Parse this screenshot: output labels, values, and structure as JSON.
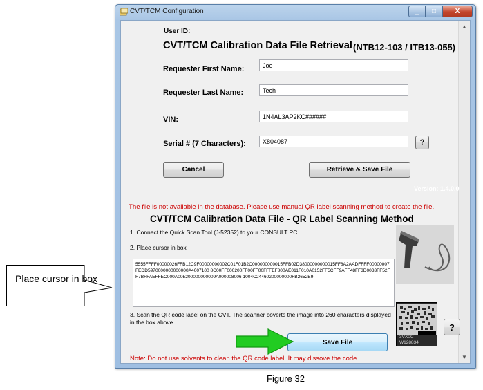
{
  "window": {
    "title": "CVT/TCM Configuration",
    "minimize": "_",
    "maximize": "□",
    "close": "X"
  },
  "form": {
    "user_id_label": "User ID:",
    "heading": "CVT/TCM Calibration Data File Retrieval",
    "heading_suffix": "(NTB12-103 / ITB13-055)",
    "first_name_label": "Requester First Name:",
    "first_name_value": "Joe",
    "last_name_label": "Requester Last Name:",
    "last_name_value": "Tech",
    "vin_label": "VIN:",
    "vin_value": "1N4AL3AP2KC######",
    "serial_label": "Serial # (7 Characters):",
    "serial_value": "X804087",
    "help_label": "?",
    "cancel_label": "Cancel",
    "retrieve_label": "Retrieve & Save File",
    "version": "Version: 1.4.0.0"
  },
  "qr_section": {
    "error_message": "The file is not available in the database.  Please use manual QR label scanning method to create the file.",
    "heading": "CVT/TCM Calibration Data File - QR Label Scanning Method",
    "step1": "1. Connect the Quick Scan Tool (J-52352) to your CONSULT PC.",
    "step2": "2. Place cursor in box",
    "scan_data": "5555FFFF00000026FFB12C9F00000000002C01F01B2C000000000015FFB02D38000000000015FF8A2AADFFFF00000007FEDD5970000000000000A4007100 8C00FF000200FF00FF00FFFEF800AE011F010A0152FF5CFF9AFF48FF3D0033FF52FF7BFFAEFFEC000A005200000000009A000008006 1004C24460200000000FB2652B9",
    "step3": "3. Scan the QR code label on the CVT.  The scanner coverts the image into 260 characters displayed in the box above.",
    "save_label": "Save File",
    "help_label": "?",
    "qr_label_text_line1": "3VX0C",
    "qr_label_text_line2": "W128834",
    "note": "Note: Do not use solvents to clean the QR code label.  It may dissove the code."
  },
  "callout": {
    "text": "Place cursor in box"
  },
  "caption": "Figure 32",
  "colors": {
    "error_red": "#cc0000",
    "arrow_green": "#22cc22",
    "title_blue": "#a9c6e5"
  }
}
